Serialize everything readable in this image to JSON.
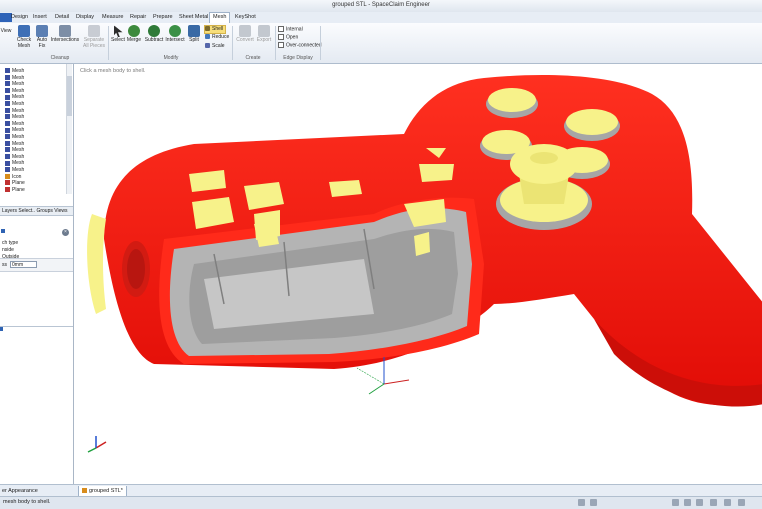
{
  "window": {
    "title": "grouped STL - SpaceClaim Engineer"
  },
  "tabs": [
    {
      "label": "",
      "file": true
    },
    {
      "label": "Design"
    },
    {
      "label": "Insert"
    },
    {
      "label": "Detail"
    },
    {
      "label": "Display"
    },
    {
      "label": "Measure"
    },
    {
      "label": "Repair"
    },
    {
      "label": "Prepare"
    },
    {
      "label": "Sheet Metal"
    },
    {
      "label": "Mesh",
      "active": true
    },
    {
      "label": "KeyShot"
    }
  ],
  "ribbon": {
    "view_label": "View",
    "check_mesh": "Check Mesh",
    "auto_fix": "Auto Fix",
    "intersections": "Intersections",
    "separate_all_pieces": "Separate All Pieces",
    "select": "Select",
    "merge": "Merge",
    "subtract": "Subtract",
    "intersect": "Intersect",
    "split": "Split",
    "shell": "Shell",
    "reduce": "Reduce",
    "scale": "Scale",
    "convert": "Convert",
    "export": "Export",
    "internal": "Internal",
    "open": "Open",
    "over_connected": "Over-connected",
    "group_cleanup": "Cleanup",
    "group_modify": "Modify",
    "group_create": "Create",
    "group_edge_display": "Edge Display"
  },
  "tree": {
    "items": [
      {
        "label": "Mesh"
      },
      {
        "label": "Mesh"
      },
      {
        "label": "Mesh"
      },
      {
        "label": "Mesh"
      },
      {
        "label": "Mesh"
      },
      {
        "label": "Mesh"
      },
      {
        "label": "Mesh"
      },
      {
        "label": "Mesh"
      },
      {
        "label": "Mesh"
      },
      {
        "label": "Mesh"
      },
      {
        "label": "Mesh"
      },
      {
        "label": "Mesh"
      },
      {
        "label": "Mesh"
      },
      {
        "label": "Mesh"
      },
      {
        "label": "Mesh"
      },
      {
        "label": "Mesh"
      },
      {
        "label": "Icon"
      },
      {
        "label": "Plane"
      },
      {
        "label": "Plane"
      }
    ]
  },
  "panel": {
    "subtabs": "Layers  Select..  Groups  Views",
    "type_label": "ch type",
    "inside": "nside",
    "outside": "Outside",
    "field_label": "ss",
    "field_value": "0mm"
  },
  "viewport": {
    "hint": "Click a mesh body to shell."
  },
  "doc_tab": {
    "label": "grouped STL*"
  },
  "bottom_tab": {
    "label": "er  Appearance"
  },
  "status": {
    "text": "mesh body to shell."
  },
  "colors": {
    "body_red": "#ff1a10",
    "button_yellow": "#f7f28a",
    "cut_gray": "#b4b4b4"
  }
}
